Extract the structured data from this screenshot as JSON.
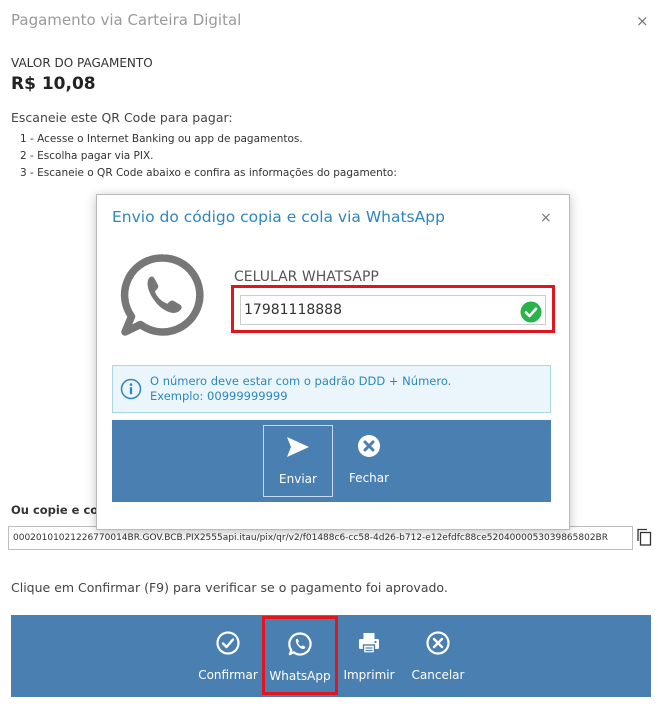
{
  "window": {
    "title": "Pagamento via Carteira Digital",
    "close": "×"
  },
  "payment": {
    "label": "VALOR DO PAGAMENTO",
    "amount": "R$ 10,08"
  },
  "instructions": {
    "heading": "Escaneie este QR Code para pagar:",
    "steps": [
      "1 - Acesse o Internet Banking ou app de pagamentos.",
      "2 - Escolha pagar via PIX.",
      "3 - Escaneie o QR Code abaixo e confira as informações do pagamento:"
    ]
  },
  "copy": {
    "label": "Ou copie e co",
    "code": "00020101021226770014BR.GOV.BCB.PIX2555api.itau/pix/qr/v2/f01488c6-cc58-4d26-b712-e12efdfc88ce5204000053039865802BR"
  },
  "confirm_text": "Clique em Confirmar (F9) para verificar se o pagamento foi aprovado.",
  "toolbar": {
    "confirmar": "Confirmar",
    "whatsapp": "WhatsApp",
    "imprimir": "Imprimir",
    "cancelar": "Cancelar"
  },
  "modal": {
    "title": "Envio do código copia e cola via WhatsApp",
    "close": "×",
    "phone_label": "CELULAR WHATSAPP",
    "phone_value": "17981118888",
    "info_line1": "O número deve estar com o padrão DDD + Número.",
    "info_line2": "Exemplo: 00999999999",
    "enviar": "Enviar",
    "fechar": "Fechar"
  },
  "colors": {
    "accent": "#2e86c1",
    "toolbar": "#4a7fb2",
    "highlight": "#e0161f",
    "success": "#2ab34a"
  }
}
